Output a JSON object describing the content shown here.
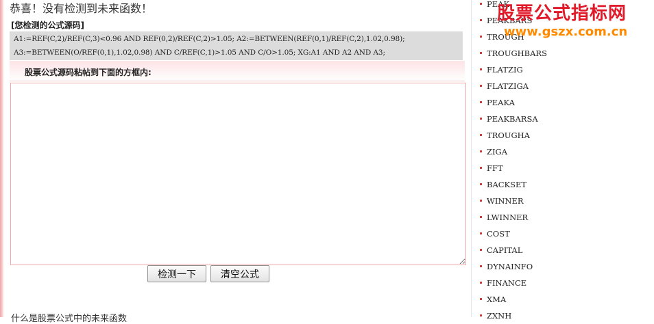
{
  "result_message": "恭喜！没有检测到未来函数！",
  "source_label": "[您检测的公式源码]",
  "code_lines": [
    "A1:=REF(C,2)/REF(C,3)<0.96 AND REF(0,2)/REF(C,2)>1.05; A2:=BETWEEN(REF(0,1)/REF(C,2),1.02,0.98);",
    "A3:=BETWEEN(O/REF(0,1),1.02,0.98) AND C/REF(C,1)>1.05 AND C/O>1.05; XG:A1 AND A2 AND A3;"
  ],
  "paste_label": "股票公式源码粘帖到下面的方框内:",
  "textarea_value": "",
  "buttons": {
    "check": "检测一下",
    "clear": "清空公式"
  },
  "bottom_text": "什么是股票公式中的未来函数",
  "functions": [
    "PEAK",
    "PEAKBARS",
    "TROUGH",
    "TROUGHBARS",
    "FLATZIG",
    "FLATZIGA",
    "PEAKA",
    "PEAKBARSA",
    "TROUGHA",
    "ZIGA",
    "FFT",
    "BACKSET",
    "WINNER",
    "LWINNER",
    "COST",
    "CAPITAL",
    "DYNAINFO",
    "FINANCE",
    "XMA",
    "ZXNH"
  ],
  "watermark": {
    "title": "股票公式指标网",
    "url": "www.gszx.com.cn"
  },
  "colors": {
    "accent": "#e11a2a",
    "url": "#ff8a00",
    "bullet": "#d23b3b"
  }
}
